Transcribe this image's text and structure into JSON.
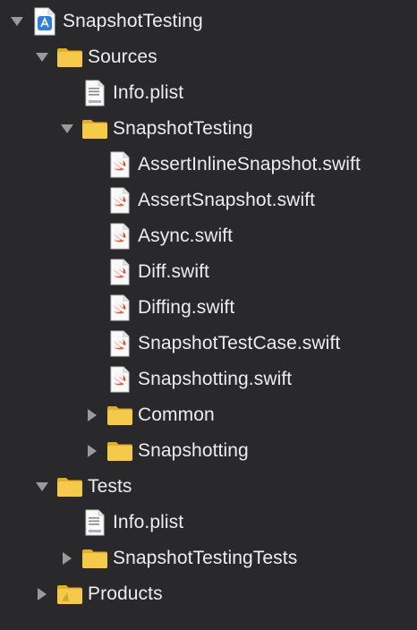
{
  "tree": [
    {
      "label": "SnapshotTesting",
      "icon": "xcode-project-icon",
      "disclosure": "expanded",
      "level": 0
    },
    {
      "label": "Sources",
      "icon": "folder-icon",
      "disclosure": "expanded",
      "level": 1
    },
    {
      "label": "Info.plist",
      "icon": "plist-file-icon",
      "disclosure": "none",
      "level": 2
    },
    {
      "label": "SnapshotTesting",
      "icon": "folder-icon",
      "disclosure": "expanded",
      "level": 2
    },
    {
      "label": "AssertInlineSnapshot.swift",
      "icon": "swift-file-icon",
      "disclosure": "none",
      "level": 3
    },
    {
      "label": "AssertSnapshot.swift",
      "icon": "swift-file-icon",
      "disclosure": "none",
      "level": 3
    },
    {
      "label": "Async.swift",
      "icon": "swift-file-icon",
      "disclosure": "none",
      "level": 3
    },
    {
      "label": "Diff.swift",
      "icon": "swift-file-icon",
      "disclosure": "none",
      "level": 3
    },
    {
      "label": "Diffing.swift",
      "icon": "swift-file-icon",
      "disclosure": "none",
      "level": 3
    },
    {
      "label": "SnapshotTestCase.swift",
      "icon": "swift-file-icon",
      "disclosure": "none",
      "level": 3
    },
    {
      "label": "Snapshotting.swift",
      "icon": "swift-file-icon",
      "disclosure": "none",
      "level": 3
    },
    {
      "label": "Common",
      "icon": "folder-icon",
      "disclosure": "collapsed",
      "level": 3
    },
    {
      "label": "Snapshotting",
      "icon": "folder-icon",
      "disclosure": "collapsed",
      "level": 3
    },
    {
      "label": "Tests",
      "icon": "folder-icon",
      "disclosure": "expanded",
      "level": 1
    },
    {
      "label": "Info.plist",
      "icon": "plist-file-icon",
      "disclosure": "none",
      "level": 2
    },
    {
      "label": "SnapshotTestingTests",
      "icon": "folder-icon",
      "disclosure": "collapsed",
      "level": 2
    },
    {
      "label": "Products",
      "icon": "products-folder-icon",
      "disclosure": "collapsed",
      "level": 1
    }
  ],
  "colors": {
    "background": "#29292b",
    "text": "#ededed",
    "folder": "#f5c94a",
    "folder_dark": "#e0ad2c",
    "disclosure": "#9a9a9c",
    "swift_orange": "#f05138",
    "project_blue": "#2f7fe0"
  }
}
